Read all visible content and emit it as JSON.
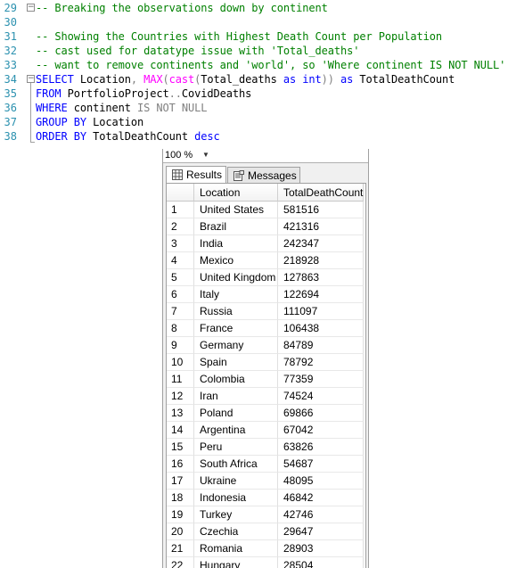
{
  "editor": {
    "lines": [
      {
        "num": "29",
        "segments": [
          {
            "t": "-- Breaking the observations down by continent",
            "c": "cmt"
          }
        ]
      },
      {
        "num": "30",
        "segments": []
      },
      {
        "num": "31",
        "segments": [
          {
            "t": "-- Showing the Countries with Highest Death Count per Population",
            "c": "cmt"
          }
        ]
      },
      {
        "num": "32",
        "segments": [
          {
            "t": "-- cast used for datatype issue with 'Total_deaths'",
            "c": "cmt"
          }
        ]
      },
      {
        "num": "33",
        "segments": [
          {
            "t": "-- want to remove continents and 'world', so 'Where continent IS NOT NULL'",
            "c": "cmt"
          }
        ]
      },
      {
        "num": "34",
        "segments": [
          {
            "t": "SELECT",
            "c": "kw"
          },
          {
            "t": " Location",
            "c": "pl"
          },
          {
            "t": ", ",
            "c": "gr"
          },
          {
            "t": "MAX",
            "c": "fn"
          },
          {
            "t": "(",
            "c": "gr"
          },
          {
            "t": "cast",
            "c": "fn"
          },
          {
            "t": "(",
            "c": "gr"
          },
          {
            "t": "Total_deaths ",
            "c": "pl"
          },
          {
            "t": "as",
            "c": "kw"
          },
          {
            "t": " ",
            "c": "pl"
          },
          {
            "t": "int",
            "c": "kw"
          },
          {
            "t": "))",
            "c": "gr"
          },
          {
            "t": " ",
            "c": "pl"
          },
          {
            "t": "as",
            "c": "kw"
          },
          {
            "t": " TotalDeathCount",
            "c": "pl"
          }
        ]
      },
      {
        "num": "35",
        "segments": [
          {
            "t": "FROM",
            "c": "kw"
          },
          {
            "t": " PortfolioProject",
            "c": "pl"
          },
          {
            "t": "..",
            "c": "gr"
          },
          {
            "t": "CovidDeaths",
            "c": "pl"
          }
        ]
      },
      {
        "num": "36",
        "segments": [
          {
            "t": "WHERE",
            "c": "kw"
          },
          {
            "t": " continent ",
            "c": "pl"
          },
          {
            "t": "IS NOT NULL",
            "c": "gr"
          }
        ]
      },
      {
        "num": "37",
        "segments": [
          {
            "t": "GROUP BY",
            "c": "kw"
          },
          {
            "t": " Location",
            "c": "pl"
          }
        ]
      },
      {
        "num": "38",
        "segments": [
          {
            "t": "ORDER BY",
            "c": "kw"
          },
          {
            "t": " TotalDeathCount ",
            "c": "pl"
          },
          {
            "t": "desc",
            "c": "kw"
          }
        ]
      }
    ],
    "colors": {
      "comment": "#008000",
      "keyword": "#0000ff",
      "function": "#ff00ff",
      "operator": "#808080",
      "line_number": "#2b91af"
    }
  },
  "results": {
    "zoom": "100 %",
    "tabs": [
      {
        "label": "Results",
        "icon": "grid-icon",
        "active": true
      },
      {
        "label": "Messages",
        "icon": "messages-icon",
        "active": false
      }
    ],
    "columns": [
      "",
      "Location",
      "TotalDeathCount"
    ],
    "rows": [
      [
        "1",
        "United States",
        "581516"
      ],
      [
        "2",
        "Brazil",
        "421316"
      ],
      [
        "3",
        "India",
        "242347"
      ],
      [
        "4",
        "Mexico",
        "218928"
      ],
      [
        "5",
        "United Kingdom",
        "127863"
      ],
      [
        "6",
        "Italy",
        "122694"
      ],
      [
        "7",
        "Russia",
        "111097"
      ],
      [
        "8",
        "France",
        "106438"
      ],
      [
        "9",
        "Germany",
        "84789"
      ],
      [
        "10",
        "Spain",
        "78792"
      ],
      [
        "11",
        "Colombia",
        "77359"
      ],
      [
        "12",
        "Iran",
        "74524"
      ],
      [
        "13",
        "Poland",
        "69866"
      ],
      [
        "14",
        "Argentina",
        "67042"
      ],
      [
        "15",
        "Peru",
        "63826"
      ],
      [
        "16",
        "South Africa",
        "54687"
      ],
      [
        "17",
        "Ukraine",
        "48095"
      ],
      [
        "18",
        "Indonesia",
        "46842"
      ],
      [
        "19",
        "Turkey",
        "42746"
      ],
      [
        "20",
        "Czechia",
        "29647"
      ],
      [
        "21",
        "Romania",
        "28903"
      ],
      [
        "22",
        "Hungary",
        "28504"
      ]
    ]
  }
}
